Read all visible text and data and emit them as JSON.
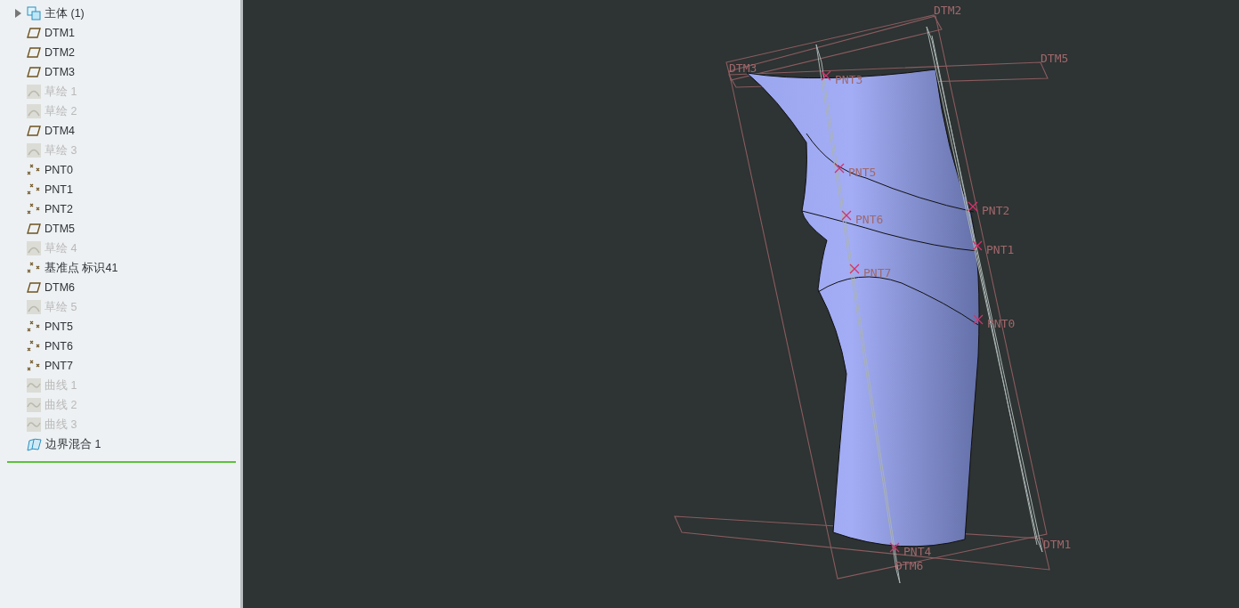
{
  "model_tree": {
    "items": [
      {
        "kind": "body",
        "label": "主体 (1)",
        "dimmed": false,
        "expanded": false
      },
      {
        "kind": "plane",
        "label": "DTM1",
        "dimmed": false
      },
      {
        "kind": "plane",
        "label": "DTM2",
        "dimmed": false
      },
      {
        "kind": "plane",
        "label": "DTM3",
        "dimmed": false
      },
      {
        "kind": "sketch",
        "label": "草绘 1",
        "dimmed": true
      },
      {
        "kind": "sketch",
        "label": "草绘 2",
        "dimmed": true
      },
      {
        "kind": "plane",
        "label": "DTM4",
        "dimmed": false
      },
      {
        "kind": "sketch",
        "label": "草绘 3",
        "dimmed": true
      },
      {
        "kind": "point",
        "label": "PNT0",
        "dimmed": false
      },
      {
        "kind": "point",
        "label": "PNT1",
        "dimmed": false
      },
      {
        "kind": "point",
        "label": "PNT2",
        "dimmed": false
      },
      {
        "kind": "plane",
        "label": "DTM5",
        "dimmed": false
      },
      {
        "kind": "sketch",
        "label": "草绘 4",
        "dimmed": true
      },
      {
        "kind": "point",
        "label": "基准点 标识41",
        "dimmed": false
      },
      {
        "kind": "plane",
        "label": "DTM6",
        "dimmed": false
      },
      {
        "kind": "sketch",
        "label": "草绘 5",
        "dimmed": true
      },
      {
        "kind": "point",
        "label": "PNT5",
        "dimmed": false
      },
      {
        "kind": "point",
        "label": "PNT6",
        "dimmed": false
      },
      {
        "kind": "point",
        "label": "PNT7",
        "dimmed": false
      },
      {
        "kind": "curve",
        "label": "曲线 1",
        "dimmed": true
      },
      {
        "kind": "curve",
        "label": "曲线 2",
        "dimmed": true
      },
      {
        "kind": "curve",
        "label": "曲线 3",
        "dimmed": true
      },
      {
        "kind": "blend",
        "label": "边界混合 1",
        "dimmed": false
      }
    ]
  },
  "viewport": {
    "labels": [
      {
        "kind": "plane",
        "text": "DTM2"
      },
      {
        "kind": "plane",
        "text": "DTM5"
      },
      {
        "kind": "plane",
        "text": "DTM3"
      },
      {
        "kind": "point",
        "text": "PNT3"
      },
      {
        "kind": "point",
        "text": "PNT5"
      },
      {
        "kind": "point",
        "text": "PNT2"
      },
      {
        "kind": "point",
        "text": "PNT6"
      },
      {
        "kind": "point",
        "text": "PNT1"
      },
      {
        "kind": "point",
        "text": "PNT7"
      },
      {
        "kind": "point",
        "text": "PNT0"
      },
      {
        "kind": "point",
        "text": "PNT4"
      },
      {
        "kind": "plane",
        "text": "DTM6"
      },
      {
        "kind": "plane",
        "text": "DTM1"
      }
    ]
  }
}
